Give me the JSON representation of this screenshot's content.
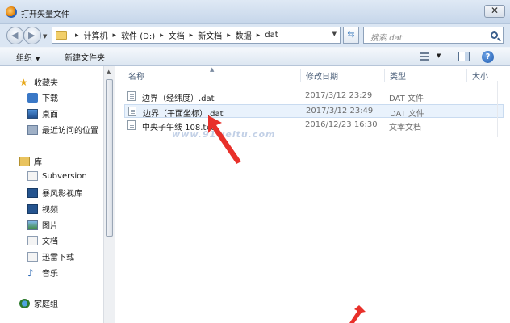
{
  "window": {
    "title": "打开矢量文件",
    "close_label": "✕"
  },
  "address": {
    "crumbs": [
      "计算机",
      "软件 (D:)",
      "文档",
      "新文档",
      "数据",
      "dat"
    ]
  },
  "search": {
    "placeholder": "搜索 dat"
  },
  "toolbar": {
    "organize_label": "组织",
    "new_folder_label": "新建文件夹",
    "help_label": "?"
  },
  "nav": {
    "favorites_label": "收藏夹",
    "favorites": [
      "下载",
      "桌面",
      "最近访问的位置"
    ],
    "libraries_label": "库",
    "libraries": [
      "Subversion",
      "暴风影视库",
      "视频",
      "图片",
      "文档",
      "迅雷下载",
      "音乐"
    ],
    "homegroup_label": "家庭组"
  },
  "columns": {
    "name": "名称",
    "date": "修改日期",
    "type": "类型",
    "size": "大小"
  },
  "files": [
    {
      "name": "边界（经纬度）.dat",
      "date": "2017/3/12 23:29",
      "type": "DAT 文件"
    },
    {
      "name": "边界（平面坐标）.dat",
      "date": "2017/3/12 23:49",
      "type": "DAT 文件"
    },
    {
      "name": "中央子午线 108.txt",
      "date": "2016/12/23 16:30",
      "type": "文本文档"
    }
  ],
  "watermark": "www.91weitu.com",
  "colors": {
    "annotation_arrow": "#e8302a",
    "selection": "#e9f2fc",
    "accent": "#2b6fb8"
  }
}
